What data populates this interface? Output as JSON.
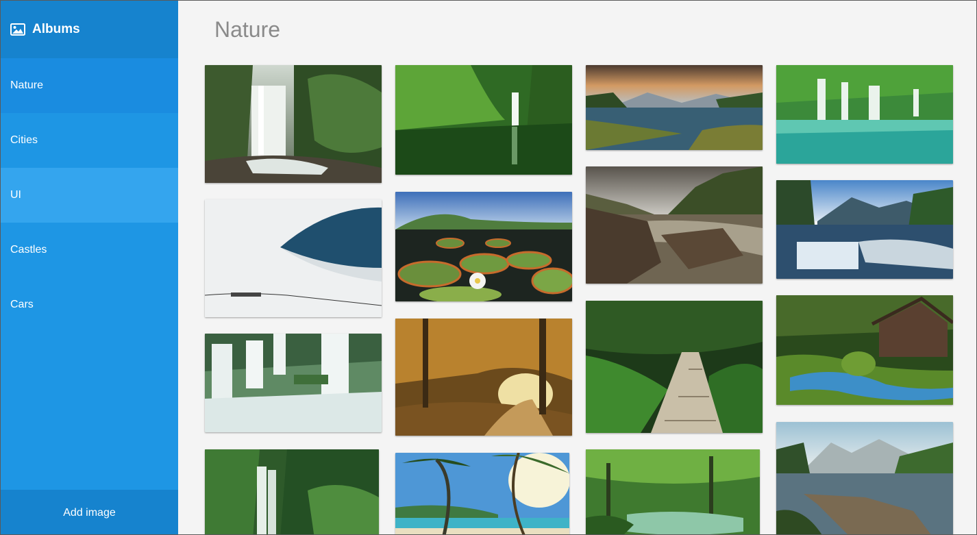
{
  "sidebar": {
    "title": "Albums",
    "items": [
      {
        "label": "Nature"
      },
      {
        "label": "Cities"
      },
      {
        "label": "UI"
      },
      {
        "label": "Castles"
      },
      {
        "label": "Cars"
      }
    ],
    "add_label": "Add image"
  },
  "main": {
    "title": "Nature",
    "photos": [
      {
        "name": "jungle-waterfall"
      },
      {
        "name": "snow-dune"
      },
      {
        "name": "terraced-waterfalls"
      },
      {
        "name": "rainforest-waterfall"
      },
      {
        "name": "green-canyon-waterfall"
      },
      {
        "name": "giant-lily-pads"
      },
      {
        "name": "autumn-forest-path"
      },
      {
        "name": "tropical-beach-palms"
      },
      {
        "name": "sunset-lake"
      },
      {
        "name": "rocky-river"
      },
      {
        "name": "fern-boardwalk"
      },
      {
        "name": "jungle-pond"
      },
      {
        "name": "turquoise-lagoon-falls"
      },
      {
        "name": "mountain-river-falls"
      },
      {
        "name": "mossy-watermill"
      },
      {
        "name": "lake-pier"
      }
    ]
  },
  "colors": {
    "sidebar": "#1e96e4",
    "sidebar_dark": "#1683ce",
    "background": "#f4f4f4",
    "title": "#8a8a8a"
  }
}
